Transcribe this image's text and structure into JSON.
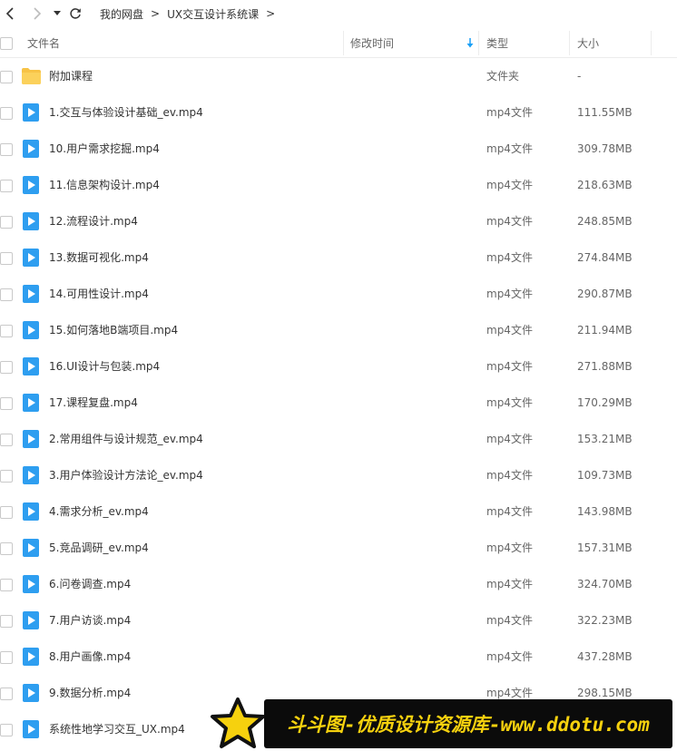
{
  "breadcrumb": {
    "items": [
      "我的网盘",
      "UX交互设计系统课"
    ],
    "separator": ">"
  },
  "columns": {
    "name": "文件名",
    "modified": "修改时间",
    "type": "类型",
    "size": "大小"
  },
  "colors": {
    "accent": "#1a9ff5",
    "folder": "#f7c346",
    "banner_bg": "#0b0b0b",
    "banner_text": "#f6d10e"
  },
  "files": [
    {
      "name": "附加课程",
      "type": "文件夹",
      "size": "-",
      "icon": "folder-icon"
    },
    {
      "name": "1.交互与体验设计基础_ev.mp4",
      "type": "mp4文件",
      "size": "111.55MB",
      "icon": "video-file-icon"
    },
    {
      "name": "10.用户需求挖掘.mp4",
      "type": "mp4文件",
      "size": "309.78MB",
      "icon": "video-file-icon"
    },
    {
      "name": "11.信息架构设计.mp4",
      "type": "mp4文件",
      "size": "218.63MB",
      "icon": "video-file-icon"
    },
    {
      "name": "12.流程设计.mp4",
      "type": "mp4文件",
      "size": "248.85MB",
      "icon": "video-file-icon"
    },
    {
      "name": "13.数据可视化.mp4",
      "type": "mp4文件",
      "size": "274.84MB",
      "icon": "video-file-icon"
    },
    {
      "name": "14.可用性设计.mp4",
      "type": "mp4文件",
      "size": "290.87MB",
      "icon": "video-file-icon"
    },
    {
      "name": "15.如何落地B端项目.mp4",
      "type": "mp4文件",
      "size": "211.94MB",
      "icon": "video-file-icon"
    },
    {
      "name": "16.UI设计与包装.mp4",
      "type": "mp4文件",
      "size": "271.88MB",
      "icon": "video-file-icon"
    },
    {
      "name": "17.课程复盘.mp4",
      "type": "mp4文件",
      "size": "170.29MB",
      "icon": "video-file-icon"
    },
    {
      "name": "2.常用组件与设计规范_ev.mp4",
      "type": "mp4文件",
      "size": "153.21MB",
      "icon": "video-file-icon"
    },
    {
      "name": "3.用户体验设计方法论_ev.mp4",
      "type": "mp4文件",
      "size": "109.73MB",
      "icon": "video-file-icon"
    },
    {
      "name": "4.需求分析_ev.mp4",
      "type": "mp4文件",
      "size": "143.98MB",
      "icon": "video-file-icon"
    },
    {
      "name": "5.竞品调研_ev.mp4",
      "type": "mp4文件",
      "size": "157.31MB",
      "icon": "video-file-icon"
    },
    {
      "name": "6.问卷调查.mp4",
      "type": "mp4文件",
      "size": "324.70MB",
      "icon": "video-file-icon"
    },
    {
      "name": "7.用户访谈.mp4",
      "type": "mp4文件",
      "size": "322.23MB",
      "icon": "video-file-icon"
    },
    {
      "name": "8.用户画像.mp4",
      "type": "mp4文件",
      "size": "437.28MB",
      "icon": "video-file-icon"
    },
    {
      "name": "9.数据分析.mp4",
      "type": "mp4文件",
      "size": "298.15MB",
      "icon": "video-file-icon"
    },
    {
      "name": "系统性地学习交互_UX.mp4",
      "type": "",
      "size": "",
      "icon": "video-file-icon"
    }
  ],
  "watermark": {
    "text": "斗斗图-优质设计资源库-www.ddotu.com"
  }
}
